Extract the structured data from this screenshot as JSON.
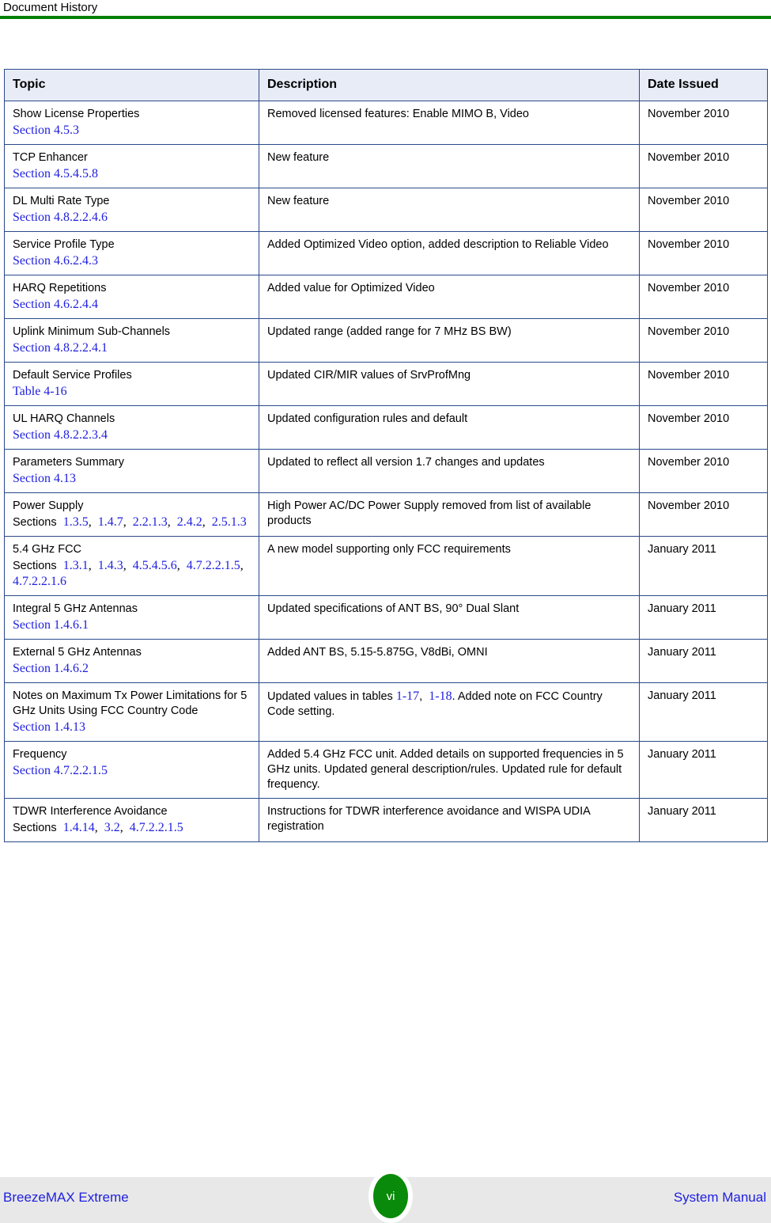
{
  "header": {
    "title": "Document History",
    "rule_color": "#008000"
  },
  "table": {
    "columns": [
      "Topic",
      "Description",
      "Date Issued"
    ],
    "header_bg": "#e8ecf7",
    "border_color": "#2a4a8a",
    "link_color": "#2020e0",
    "rows": [
      {
        "topic_title": "Show License Properties",
        "ref_label": "",
        "refs": [
          "Section 4.5.3"
        ],
        "description": "Removed licensed features: Enable MIMO B, Video",
        "description_links": [],
        "date": "November 2010"
      },
      {
        "topic_title": "TCP Enhancer",
        "ref_label": "",
        "refs": [
          "Section 4.5.4.5.8"
        ],
        "description": "New feature",
        "description_links": [],
        "date": "November 2010"
      },
      {
        "topic_title": "DL Multi Rate Type",
        "ref_label": "",
        "refs": [
          "Section 4.8.2.2.4.6"
        ],
        "description": "New feature",
        "description_links": [],
        "date": "November 2010"
      },
      {
        "topic_title": "Service Profile Type",
        "ref_label": "",
        "refs": [
          "Section 4.6.2.4.3"
        ],
        "description": "Added Optimized Video option, added description to Reliable Video",
        "description_links": [],
        "date": "November 2010"
      },
      {
        "topic_title": "HARQ Repetitions",
        "ref_label": "",
        "refs": [
          "Section 4.6.2.4.4"
        ],
        "description": "Added value for Optimized Video",
        "description_links": [],
        "date": "November 2010"
      },
      {
        "topic_title": "Uplink Minimum Sub-Channels",
        "ref_label": "",
        "refs": [
          "Section 4.8.2.2.4.1"
        ],
        "description": "Updated range (added range for 7 MHz BS BW)",
        "description_links": [],
        "date": "November 2010"
      },
      {
        "topic_title": "Default Service Profiles",
        "ref_label": "",
        "refs": [
          "Table 4-16"
        ],
        "description": "Updated CIR/MIR values of SrvProfMng",
        "description_links": [],
        "date": "November 2010"
      },
      {
        "topic_title": "UL HARQ Channels",
        "ref_label": "",
        "refs": [
          "Section 4.8.2.2.3.4"
        ],
        "description": "Updated configuration rules and default",
        "description_links": [],
        "date": "November 2010"
      },
      {
        "topic_title": "Parameters Summary",
        "ref_label": "",
        "refs": [
          "Section 4.13"
        ],
        "description": "Updated to reflect all version 1.7 changes and updates",
        "description_links": [],
        "date": "November 2010"
      },
      {
        "topic_title": "Power Supply",
        "ref_label": "Sections",
        "refs": [
          "1.3.5",
          "1.4.7",
          "2.2.1.3",
          "2.4.2",
          "2.5.1.3"
        ],
        "description": "High Power AC/DC Power Supply removed from list of available products",
        "description_links": [],
        "date": "November 2010"
      },
      {
        "topic_title": "5.4 GHz FCC",
        "ref_label": "Sections",
        "refs": [
          "1.3.1",
          "1.4.3",
          "4.5.4.5.6",
          "4.7.2.2.1.5",
          "4.7.2.2.1.6"
        ],
        "description": "A new model supporting only FCC requirements",
        "description_links": [],
        "date": "January 2011"
      },
      {
        "topic_title": "Integral 5 GHz Antennas",
        "ref_label": "",
        "refs": [
          "Section 1.4.6.1"
        ],
        "description": "Updated specifications of ANT BS, 90° Dual Slant",
        "description_links": [],
        "date": "January 2011"
      },
      {
        "topic_title": "External 5 GHz Antennas",
        "ref_label": "",
        "refs": [
          "Section 1.4.6.2"
        ],
        "description": "Added ANT BS, 5.15-5.875G, V8dBi, OMNI",
        "description_links": [],
        "date": "January 2011"
      },
      {
        "topic_title": "Notes on Maximum Tx Power Limitations for 5 GHz Units Using FCC Country Code",
        "ref_label": "",
        "refs": [
          "Section 1.4.13"
        ],
        "description_prefix": "Updated values in tables ",
        "description_links": [
          "1-17",
          "1-18"
        ],
        "description_suffix": ". Added note on FCC Country Code setting.",
        "description": "",
        "date": "January 2011"
      },
      {
        "topic_title": "Frequency",
        "ref_label": "",
        "refs": [
          "Section 4.7.2.2.1.5"
        ],
        "description": "Added 5.4 GHz FCC unit. Added details on supported frequencies in 5 GHz units. Updated general description/rules. Updated rule for default frequency.",
        "description_links": [],
        "date": "January 2011"
      },
      {
        "topic_title": "TDWR Interference Avoidance",
        "ref_label": "Sections",
        "refs": [
          "1.4.14",
          "3.2",
          "4.7.2.2.1.5"
        ],
        "description": "Instructions for TDWR interference avoidance and WISPA UDIA registration",
        "description_links": [],
        "date": "January 2011"
      }
    ]
  },
  "footer": {
    "left": "BreezeMAX Extreme",
    "page_number": "vi",
    "right": "System Manual",
    "badge_color": "#0a8a0a",
    "bg": "#e8e8e8"
  }
}
